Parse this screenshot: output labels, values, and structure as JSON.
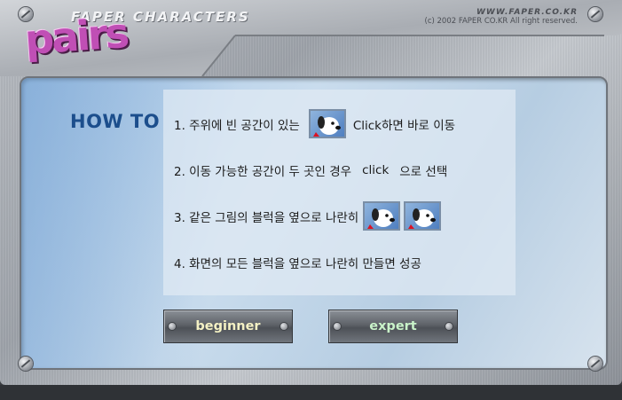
{
  "header": {
    "brand_subtitle": "FAPER CHARACTERS",
    "logo_text": "pairs",
    "url": "WWW.FAPER.CO.KR",
    "copyright": "(c) 2002 FAPER CO.KR All right reserved."
  },
  "howto": {
    "title": "HOW TO",
    "lines": [
      {
        "before": "1. 주위에 빈 공간이 있는",
        "after": "Click하면 바로 이동",
        "dogs": 1
      },
      {
        "before": "2. 이동 가능한 공간이 두 곳인 경우",
        "middle": "click",
        "after": "으로 선택",
        "dogs": 0
      },
      {
        "before": "3. 같은 그림의 블럭을 옆으로 나란히",
        "after": "",
        "dogs": 2
      },
      {
        "before": "4. 화면의 모든 블럭을 옆으로 나란히 만들면 성공",
        "after": "",
        "dogs": 0
      }
    ]
  },
  "buttons": {
    "beginner": {
      "label": "beginner",
      "color": "#f4f1c4"
    },
    "expert": {
      "label": "expert",
      "color": "#c9f3c9"
    }
  },
  "colors": {
    "howto_title": "#1c4e8c",
    "logo": "#c04fb5"
  }
}
